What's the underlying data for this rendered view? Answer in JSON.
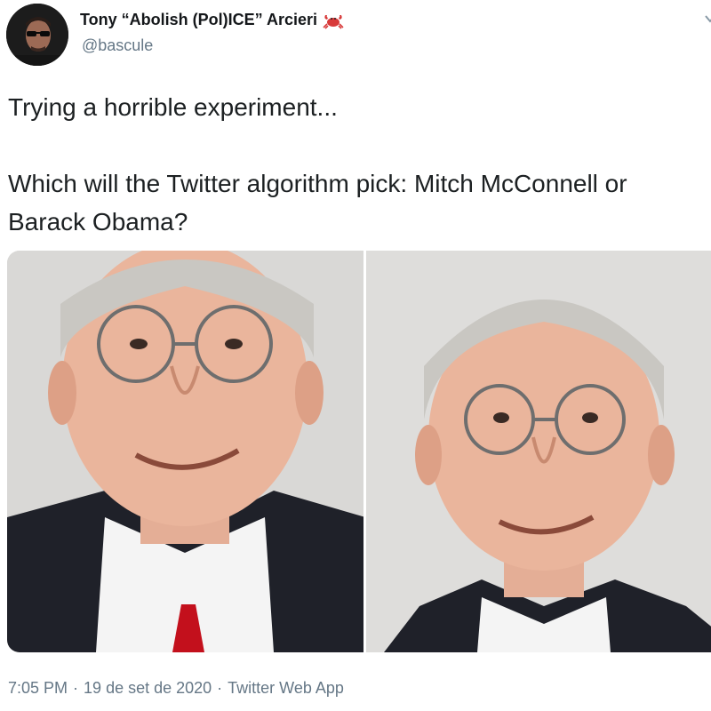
{
  "author": {
    "display_name": "Tony “Abolish (Pol)ICE” Arcieri",
    "handle": "@bascule",
    "avatar_icon": "avatar-sunglasses-portrait",
    "badge_icon": "crab-emoji-icon"
  },
  "tweet": {
    "line1": "Trying a horrible experiment...",
    "line2": "Which will the Twitter algorithm pick: Mitch McConnell or Barack Obama?"
  },
  "media": {
    "left_photo_icon": "portrait-photo-icon",
    "right_photo_icon": "portrait-photo-icon"
  },
  "meta": {
    "time": "7:05 PM",
    "separator": "·",
    "date": "19 de set de 2020",
    "source": "Twitter Web App"
  },
  "colors": {
    "text": "#14171a",
    "secondary": "#657786",
    "tie_red": "#c3101c"
  }
}
